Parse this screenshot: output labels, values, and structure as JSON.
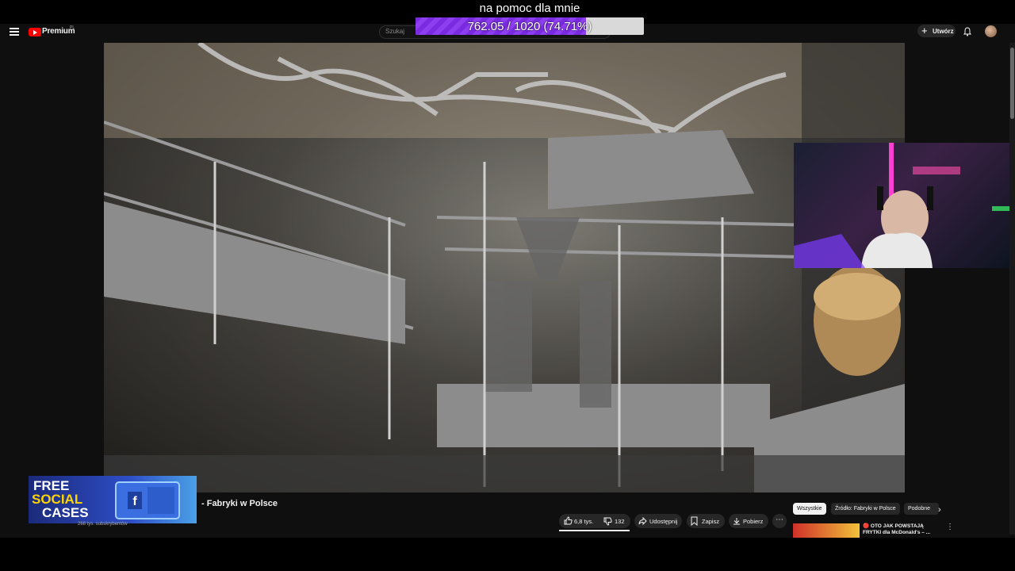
{
  "stream_overlay": {
    "goal_title": "na pomoc dla mnie",
    "goal_progress_text": "762.05 / 1020 (74.71%)",
    "goal_fraction": 0.7471,
    "goal_color": "#7a2be0"
  },
  "header": {
    "brand": "Premium",
    "brand_region": "PL",
    "search_placeholder": "Szukaj",
    "create_label": "Utwórz",
    "menu_icon": "hamburger-icon",
    "notification_icon": "bell-icon",
    "brand_color": "#ff0000"
  },
  "promo": {
    "line1": "FREE",
    "line2": "SOCIAL",
    "line3": "CASES"
  },
  "video": {
    "title": "- Fabryki w Polsce",
    "subscribers": "268 tys. subskrybentów"
  },
  "actions": {
    "likes": "6,8 tys.",
    "dislikes": "132",
    "share": "Udostępnij",
    "save": "Zapisz",
    "download": "Pobierz",
    "more_icon": "more-horizontal-icon"
  },
  "chips": {
    "all": "Wszystkie",
    "source": "Źródło: Fabryki w Polsce",
    "similar": "Podobne"
  },
  "recommendation": {
    "title": "🔴 OTO JAK POWSTAJĄ FRYTKI dla McDonald's – ..."
  }
}
